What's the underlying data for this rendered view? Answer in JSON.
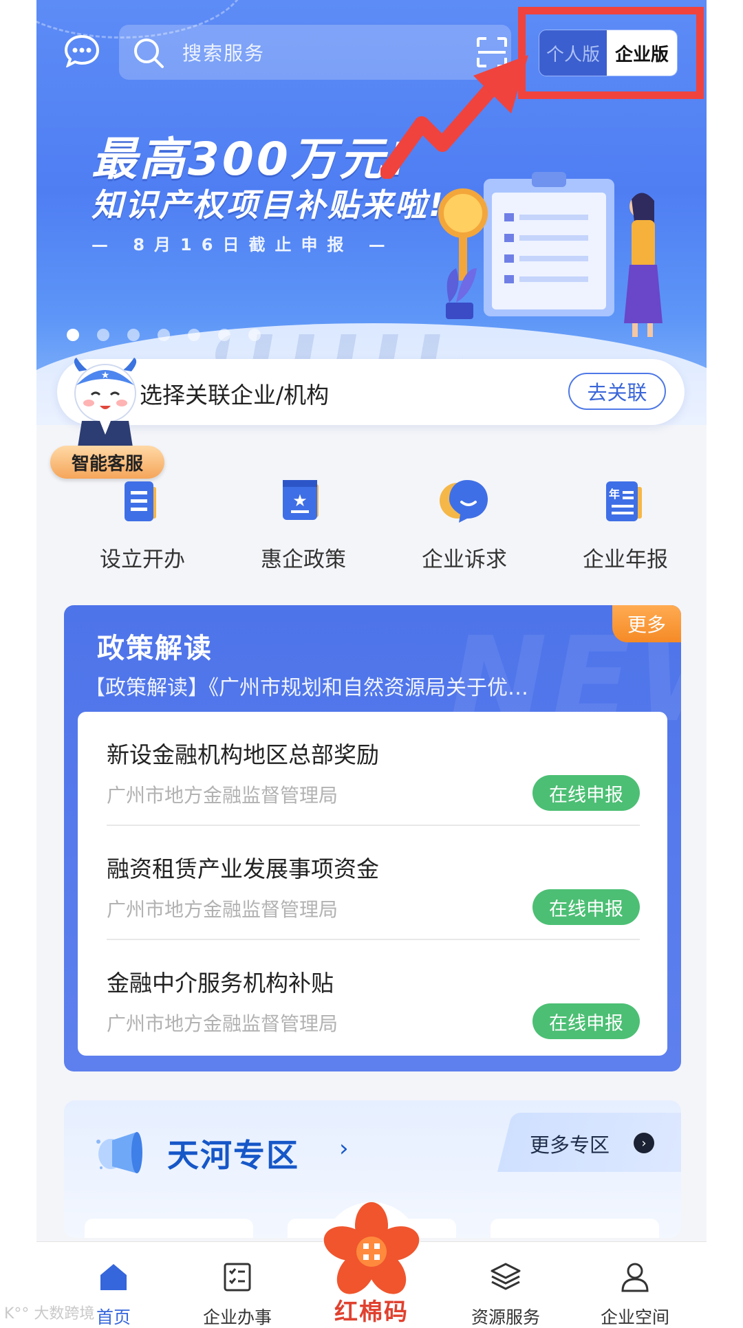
{
  "search": {
    "placeholder": "搜索服务"
  },
  "version_toggle": {
    "personal": "个人版",
    "enterprise": "企业版"
  },
  "banner": {
    "headline1": "最高300万元!",
    "headline2": "知识产权项目补贴来啦!",
    "deadline": "— 8月16日截止申报 —",
    "dot_count": 7,
    "active_dot": 0
  },
  "link_card": {
    "label": "选择关联企业/机构",
    "button": "去关联"
  },
  "assistant": {
    "badge": "智能客服"
  },
  "services": [
    {
      "label": "设立开办",
      "icon": "document-icon"
    },
    {
      "label": "惠企政策",
      "icon": "star-folder-icon"
    },
    {
      "label": "企业诉求",
      "icon": "chat-bubble-icon"
    },
    {
      "label": "企业年报",
      "icon": "annual-report-icon"
    }
  ],
  "policy": {
    "title": "政策解读",
    "more": "更多",
    "bg_word": "NEW",
    "subtitle": "【政策解读】《广州市规划和自然资源局关于优…",
    "items": [
      {
        "name": "新设金融机构地区总部奖励",
        "org": "广州市地方金融监督管理局",
        "action": "在线申报"
      },
      {
        "name": "融资租赁产业发展事项资金",
        "org": "广州市地方金融监督管理局",
        "action": "在线申报"
      },
      {
        "name": "金融中介服务机构补贴",
        "org": "广州市地方金融监督管理局",
        "action": "在线申报"
      }
    ]
  },
  "zone": {
    "title": "天河专区",
    "arrow": "›",
    "more": "更多专区",
    "more_icon": "›"
  },
  "bottom_nav": {
    "home": "首页",
    "affairs": "企业办事",
    "center": "红棉码",
    "resources": "资源服务",
    "space": "企业空间"
  },
  "watermark": "K°° 大数跨境",
  "colors": {
    "accent_blue": "#4e74ea",
    "apply_green": "#4cbf74",
    "more_orange": "#f58a26",
    "annotation_red": "#f0433d",
    "center_red": "#e0412f"
  }
}
